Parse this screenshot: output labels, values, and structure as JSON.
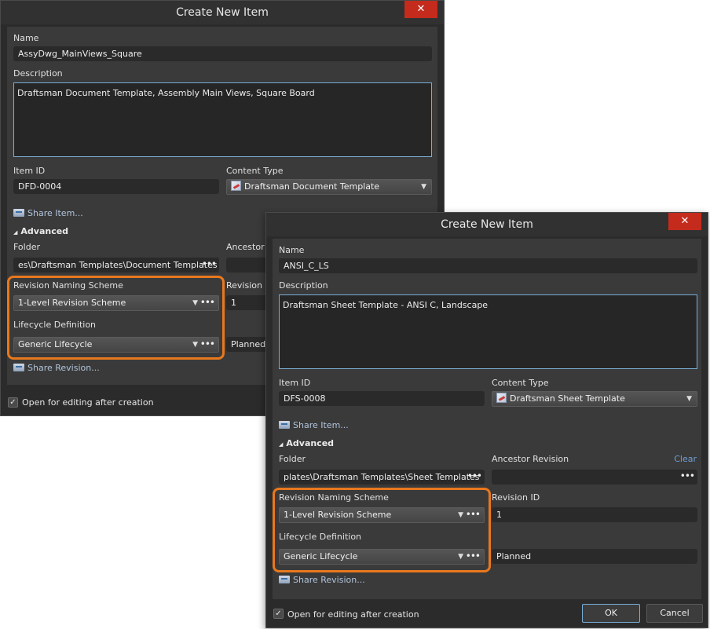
{
  "dialog_back": {
    "title": "Create New Item",
    "close_label": "✕",
    "name_label": "Name",
    "name_value": "AssyDwg_MainViews_Square",
    "description_label": "Description",
    "description_value": "Draftsman Document Template, Assembly Main Views, Square Board",
    "item_id_label": "Item ID",
    "item_id_value": "DFD-0004",
    "content_type_label": "Content Type",
    "content_type_value": "Draftsman Document Template",
    "share_item_label": "Share Item...",
    "advanced_label": "Advanced",
    "folder_label": "Folder",
    "folder_value": "es\\Draftsman Templates\\Document Templates",
    "ancestor_label": "Ancestor R",
    "revision_scheme_label": "Revision Naming Scheme",
    "revision_scheme_value": "1-Level Revision Scheme",
    "revision_id_label": "Revision II",
    "revision_id_value": "1",
    "lifecycle_label": "Lifecycle Definition",
    "lifecycle_value": "Generic Lifecycle",
    "lifecycle_state_value": "Planned",
    "share_revision_label": "Share Revision...",
    "open_for_editing_label": "Open for editing after creation"
  },
  "dialog_front": {
    "title": "Create New Item",
    "close_label": "✕",
    "name_label": "Name",
    "name_value": "ANSI_C_LS",
    "description_label": "Description",
    "description_value": "Draftsman Sheet Template - ANSI C, Landscape",
    "item_id_label": "Item ID",
    "item_id_value": "DFS-0008",
    "content_type_label": "Content Type",
    "content_type_value": "Draftsman Sheet Template",
    "share_item_label": "Share Item...",
    "advanced_label": "Advanced",
    "folder_label": "Folder",
    "folder_value": "plates\\Draftsman Templates\\Sheet Templates",
    "ancestor_label": "Ancestor Revision",
    "clear_label": "Clear",
    "revision_scheme_label": "Revision Naming Scheme",
    "revision_scheme_value": "1-Level Revision Scheme",
    "revision_id_label": "Revision ID",
    "revision_id_value": "1",
    "lifecycle_label": "Lifecycle Definition",
    "lifecycle_value": "Generic Lifecycle",
    "lifecycle_state_value": "Planned",
    "share_revision_label": "Share Revision...",
    "open_for_editing_label": "Open for editing after creation",
    "ok_label": "OK",
    "cancel_label": "Cancel"
  },
  "icons": {
    "dropdown_arrow": "▼",
    "more_dots": "•••",
    "collapse_triangle": "◢",
    "checkmark": "✓"
  },
  "colors": {
    "highlight": "#e8781e",
    "close_button": "#c42b1c",
    "focus_border": "#7aaed6"
  }
}
